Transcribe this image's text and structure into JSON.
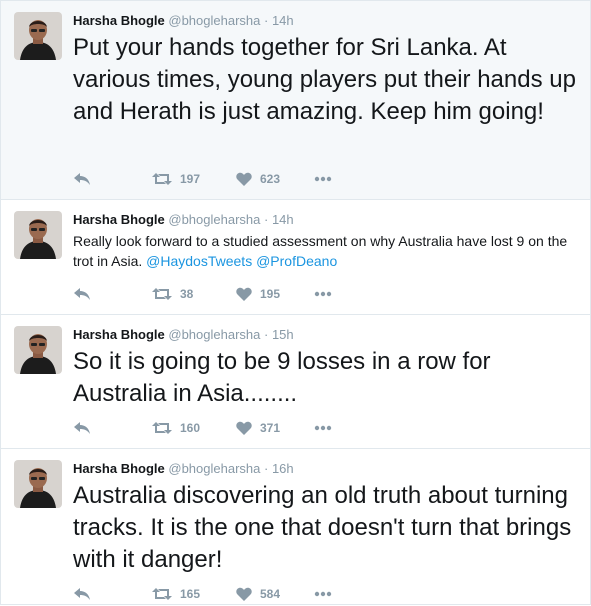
{
  "author": {
    "name": "Harsha Bhogle",
    "handle": "@bhogleharsha"
  },
  "separator": "·",
  "tweets": [
    {
      "time": "14h",
      "text": "Put your hands together for Sri Lanka. At various times, young players put their hands up and Herath is just amazing. Keep him going!",
      "retweets": "197",
      "likes": "623"
    },
    {
      "time": "14h",
      "text": "Really look forward to a studied assessment on why Australia have lost 9 on the trot in Asia.",
      "mention1": "@HaydosTweets",
      "mention2": "@ProfDeano",
      "retweets": "38",
      "likes": "195"
    },
    {
      "time": "15h",
      "text": "So it is going to be 9 losses in a row for Australia in Asia........",
      "retweets": "160",
      "likes": "371"
    },
    {
      "time": "16h",
      "text": "Australia discovering an old truth about turning tracks. It is the one that doesn't turn that brings with it danger!",
      "retweets": "165",
      "likes": "584"
    }
  ],
  "icons": {
    "reply": "reply-icon",
    "retweet": "retweet-icon",
    "like": "heart-icon",
    "more": "more-icon"
  },
  "colors": {
    "muted": "#8899a6",
    "link": "#1b95e0",
    "highlight_bg": "#f5f8fa",
    "border": "#e1e8ed"
  }
}
